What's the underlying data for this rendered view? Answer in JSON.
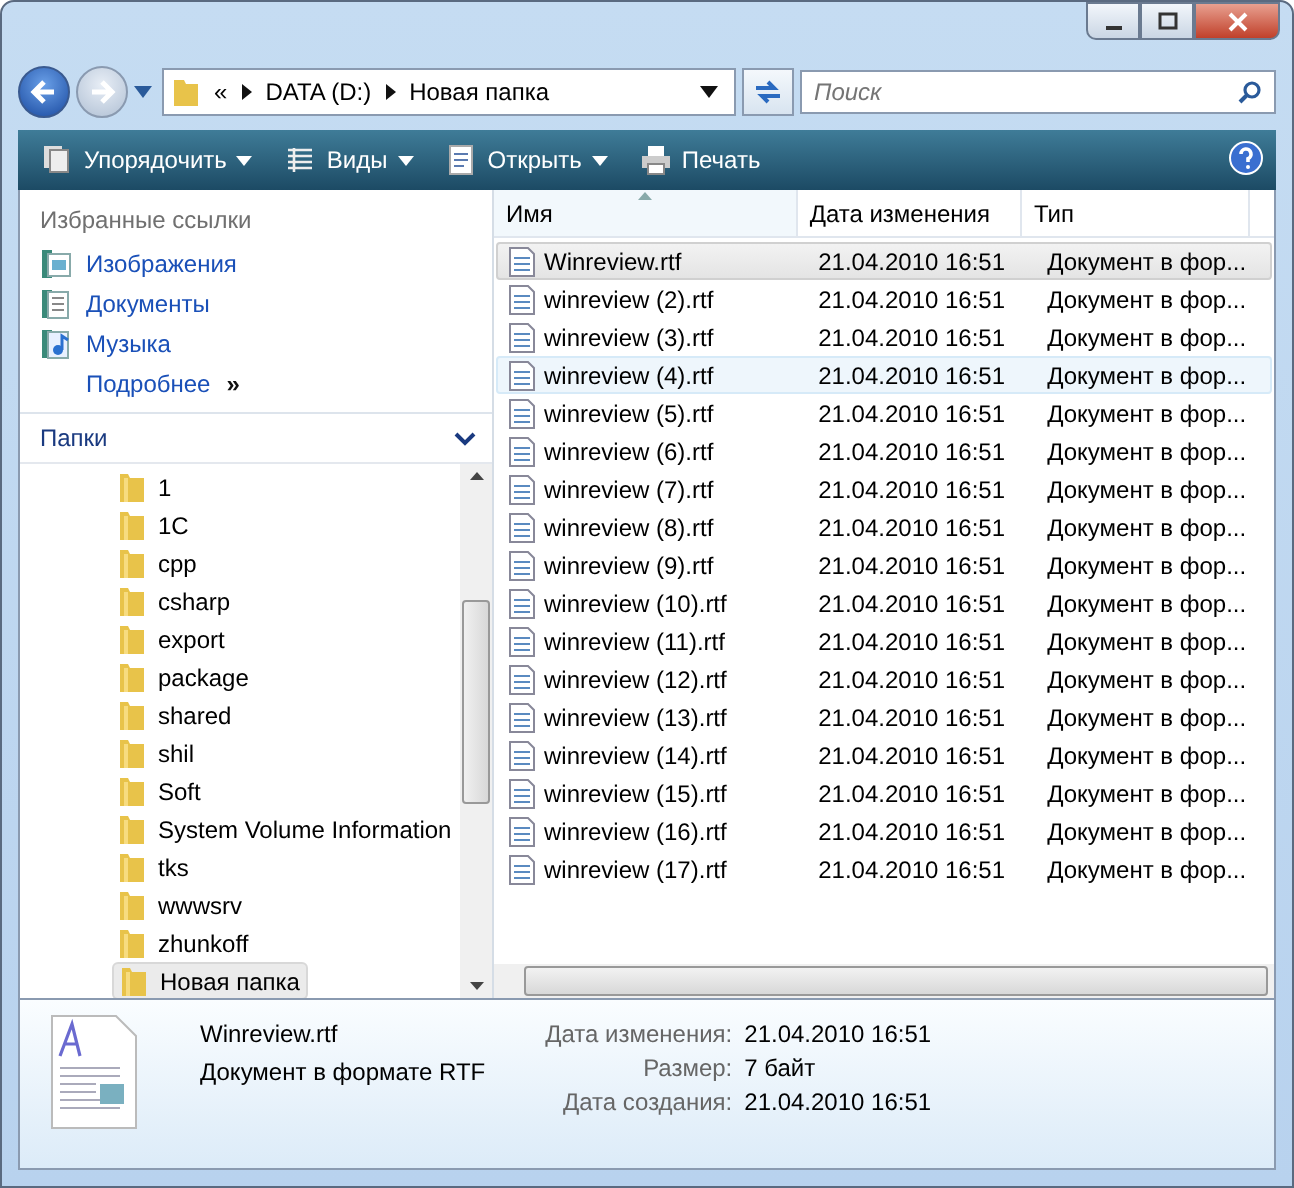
{
  "address": {
    "crumbs": [
      "«",
      "DATA (D:)",
      "Новая папка"
    ]
  },
  "search": {
    "placeholder": "Поиск"
  },
  "toolbar": [
    {
      "label": "Упорядочить",
      "kind": "organize"
    },
    {
      "label": "Виды",
      "kind": "views"
    },
    {
      "label": "Открыть",
      "kind": "open"
    },
    {
      "label": "Печать",
      "kind": "print"
    }
  ],
  "favorites": {
    "title": "Избранные ссылки",
    "items": [
      {
        "label": "Изображения",
        "kind": "pictures"
      },
      {
        "label": "Документы",
        "kind": "documents"
      },
      {
        "label": "Музыка",
        "kind": "music"
      }
    ],
    "more": "Подробнее",
    "more_arrow": "»"
  },
  "folders": {
    "title": "Папки",
    "items": [
      {
        "label": "1",
        "selected": false
      },
      {
        "label": "1C",
        "selected": false
      },
      {
        "label": "cpp",
        "selected": false
      },
      {
        "label": "csharp",
        "selected": false
      },
      {
        "label": "export",
        "selected": false
      },
      {
        "label": "package",
        "selected": false
      },
      {
        "label": "shared",
        "selected": false
      },
      {
        "label": "shil",
        "selected": false
      },
      {
        "label": "Soft",
        "selected": false
      },
      {
        "label": "System Volume Information",
        "selected": false
      },
      {
        "label": "tks",
        "selected": false
      },
      {
        "label": "wwwsrv",
        "selected": false
      },
      {
        "label": "zhunkoff",
        "selected": false
      },
      {
        "label": "Новая папка",
        "selected": true
      }
    ]
  },
  "table": {
    "columns": [
      "Имя",
      "Дата изменения",
      "Тип"
    ],
    "rows": [
      {
        "name": "Winreview.rtf",
        "date": "21.04.2010 16:51",
        "type": "Документ в фор...",
        "selected": true,
        "hover": false
      },
      {
        "name": "winreview (2).rtf",
        "date": "21.04.2010 16:51",
        "type": "Документ в фор...",
        "selected": false,
        "hover": false
      },
      {
        "name": "winreview (3).rtf",
        "date": "21.04.2010 16:51",
        "type": "Документ в фор...",
        "selected": false,
        "hover": false
      },
      {
        "name": "winreview (4).rtf",
        "date": "21.04.2010 16:51",
        "type": "Документ в фор...",
        "selected": false,
        "hover": true
      },
      {
        "name": "winreview (5).rtf",
        "date": "21.04.2010 16:51",
        "type": "Документ в фор...",
        "selected": false,
        "hover": false
      },
      {
        "name": "winreview (6).rtf",
        "date": "21.04.2010 16:51",
        "type": "Документ в фор...",
        "selected": false,
        "hover": false
      },
      {
        "name": "winreview (7).rtf",
        "date": "21.04.2010 16:51",
        "type": "Документ в фор...",
        "selected": false,
        "hover": false
      },
      {
        "name": "winreview (8).rtf",
        "date": "21.04.2010 16:51",
        "type": "Документ в фор...",
        "selected": false,
        "hover": false
      },
      {
        "name": "winreview (9).rtf",
        "date": "21.04.2010 16:51",
        "type": "Документ в фор...",
        "selected": false,
        "hover": false
      },
      {
        "name": "winreview (10).rtf",
        "date": "21.04.2010 16:51",
        "type": "Документ в фор...",
        "selected": false,
        "hover": false
      },
      {
        "name": "winreview (11).rtf",
        "date": "21.04.2010 16:51",
        "type": "Документ в фор...",
        "selected": false,
        "hover": false
      },
      {
        "name": "winreview (12).rtf",
        "date": "21.04.2010 16:51",
        "type": "Документ в фор...",
        "selected": false,
        "hover": false
      },
      {
        "name": "winreview (13).rtf",
        "date": "21.04.2010 16:51",
        "type": "Документ в фор...",
        "selected": false,
        "hover": false
      },
      {
        "name": "winreview (14).rtf",
        "date": "21.04.2010 16:51",
        "type": "Документ в фор...",
        "selected": false,
        "hover": false
      },
      {
        "name": "winreview (15).rtf",
        "date": "21.04.2010 16:51",
        "type": "Документ в фор...",
        "selected": false,
        "hover": false
      },
      {
        "name": "winreview (16).rtf",
        "date": "21.04.2010 16:51",
        "type": "Документ в фор...",
        "selected": false,
        "hover": false
      },
      {
        "name": "winreview (17).rtf",
        "date": "21.04.2010 16:51",
        "type": "Документ в фор...",
        "selected": false,
        "hover": false
      }
    ]
  },
  "details": {
    "name": "Winreview.rtf",
    "type": "Документ в формате RTF",
    "fields": [
      {
        "label": "Дата изменения:",
        "value": "21.04.2010 16:51"
      },
      {
        "label": "Размер:",
        "value": "7 байт"
      },
      {
        "label": "Дата создания:",
        "value": "21.04.2010 16:51"
      }
    ]
  }
}
